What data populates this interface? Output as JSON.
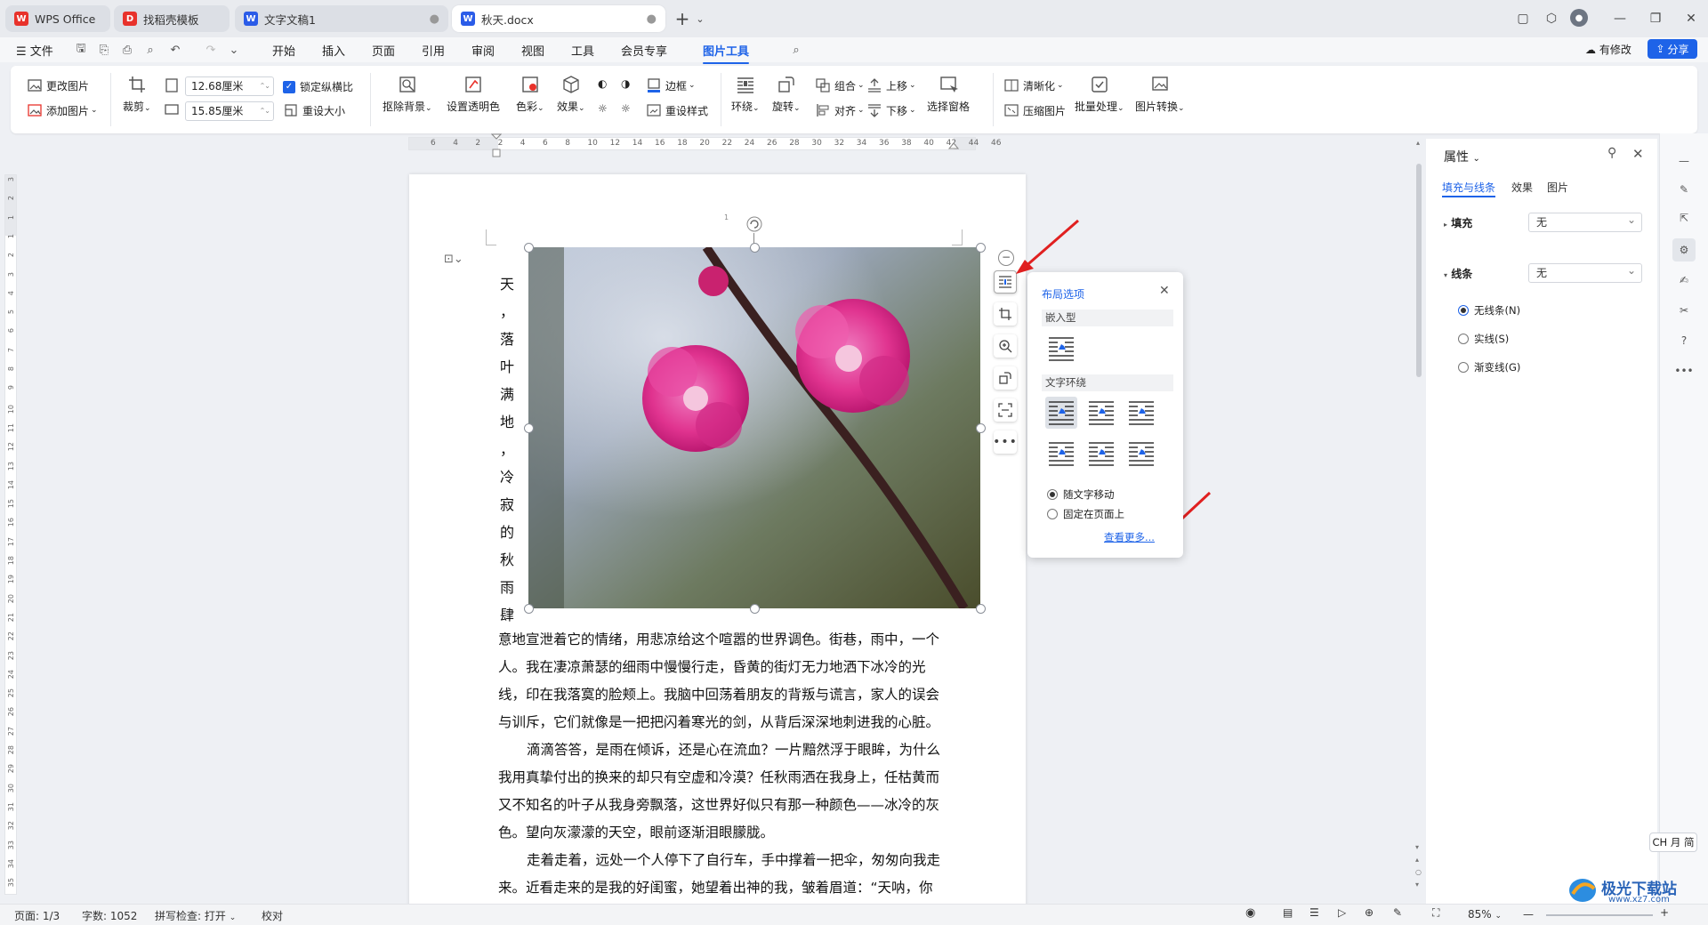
{
  "titlebar": {
    "tabs": [
      {
        "label": "WPS Office",
        "icon": "wps-logo-icon",
        "color": "#e8322b"
      },
      {
        "label": "找稻壳模板",
        "icon": "docer-icon",
        "color": "#e8322b"
      },
      {
        "label": "文字文稿1",
        "icon": "word-doc-icon",
        "color": "#2b5ce8"
      },
      {
        "label": "秋天.docx",
        "icon": "word-doc-icon",
        "color": "#2b5ce8"
      }
    ],
    "new_tab": "+"
  },
  "menubar": {
    "file": "文件",
    "items": [
      "开始",
      "插入",
      "页面",
      "引用",
      "审阅",
      "视图",
      "工具",
      "会员专享",
      "图片工具"
    ],
    "active": "图片工具",
    "modified": "有修改",
    "share": "分享"
  },
  "ribbon": {
    "change_picture": "更改图片",
    "add_picture": "添加图片",
    "crop": "裁剪",
    "width_value": "12.68厘米",
    "height_value": "15.85厘米",
    "lock_ratio": "锁定纵横比",
    "reset_size": "重设大小",
    "remove_bg": "抠除背景",
    "set_transparent": "设置透明色",
    "color": "色彩",
    "effects": "效果",
    "border": "边框",
    "reset_style": "重设样式",
    "wrap": "环绕",
    "rotate": "旋转",
    "group": "组合",
    "align": "对齐",
    "bring_forward": "上移",
    "send_backward": "下移",
    "selection_pane": "选择窗格",
    "sharpen": "清晰化",
    "compress": "压缩图片",
    "batch": "批量处理",
    "convert": "图片转换"
  },
  "ruler": {
    "h_numbers": [
      "6",
      "4",
      "2",
      "2",
      "4",
      "6",
      "8",
      "10",
      "12",
      "14",
      "16",
      "18",
      "20",
      "22",
      "24",
      "26",
      "28",
      "30",
      "32",
      "34",
      "36",
      "38",
      "40",
      "42",
      "44",
      "46"
    ],
    "v_numbers": [
      "3",
      "2",
      "1",
      "1",
      "2",
      "3",
      "4",
      "5",
      "6",
      "7",
      "8",
      "9",
      "10",
      "11",
      "12",
      "13",
      "14",
      "15",
      "16",
      "17",
      "18",
      "19",
      "20",
      "21",
      "22",
      "23",
      "24",
      "25",
      "26",
      "27",
      "28",
      "29",
      "30",
      "31",
      "32",
      "33",
      "34",
      "35"
    ]
  },
  "document": {
    "page_number": "1",
    "vertical_chars": [
      "天",
      "，",
      "落",
      "叶",
      "满",
      "地",
      "，",
      "冷",
      "寂",
      "的",
      "秋",
      "雨",
      "肆"
    ],
    "paragraphs": [
      "意地宣泄着它的情绪，用悲凉给这个喧嚣的世界调色。街巷，雨中，一个人。我在凄凉萧瑟的细雨中慢慢行走，昏黄的街灯无力地洒下冰冷的光线，印在我落寞的脸颊上。我脑中回荡着朋友的背叛与谎言，家人的误会与训斥，它们就像是一把把闪着寒光的剑，从背后深深地刺进我的心脏。",
      "滴滴答答，是雨在倾诉，还是心在流血？一片黯然浮于眼眸，为什么我用真挚付出的换来的却只有空虚和冷漠？任秋雨洒在我身上，任枯黄而又不知名的叶子从我身旁飘落，这世界好似只有那一种颜色——冰冷的灰色。望向灰濛濛的天空，眼前逐渐泪眼朦胧。",
      "走着走着，远处一个人停下了自行车，手中撑着一把伞，匆匆向我走来。近看走来的是我的好闺蜜，她望着出神的我，皱着眉道：“天呐，你"
    ]
  },
  "layout_popup": {
    "title": "布局选项",
    "inline_section": "嵌入型",
    "wrap_section": "文字环绕",
    "move_with_text": "随文字移动",
    "fix_on_page": "固定在页面上",
    "see_more": "查看更多..."
  },
  "properties_panel": {
    "title": "属性",
    "tabs": [
      "填充与线条",
      "效果",
      "图片"
    ],
    "fill_label": "填充",
    "fill_value": "无",
    "line_label": "线条",
    "line_value": "无",
    "line_options": [
      "无线条(N)",
      "实线(S)",
      "渐变线(G)"
    ]
  },
  "ime": "CH ⽉ 简",
  "statusbar": {
    "page": "页面: 1/3",
    "words": "字数: 1052",
    "spell": "拼写检查: 打开",
    "proofread": "校对",
    "zoom": "85%"
  },
  "watermark": {
    "line1": "极光下载站",
    "line2": "www.xz7.com"
  },
  "colors": {
    "accent": "#1e63e8",
    "wps_red": "#e8322b",
    "arrow_red": "#e02020"
  }
}
